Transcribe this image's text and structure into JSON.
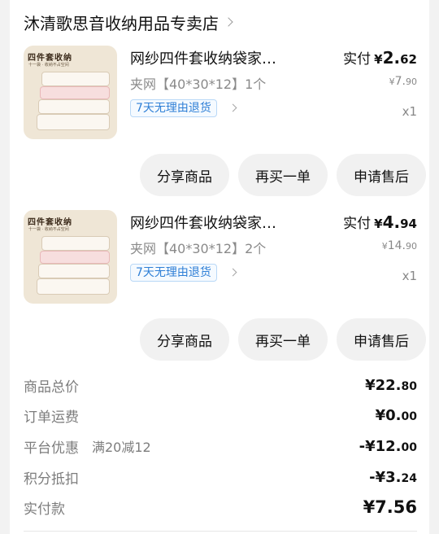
{
  "store": {
    "name": "沐清歌思音收纳用品专卖店"
  },
  "items": [
    {
      "thumb_title": "四件套收纳",
      "thumb_sub": "十一袋 · 收纳不占空间",
      "name": "网纱四件套收纳袋家用卧室衣物整理",
      "paid_label": "实付",
      "paid_currency": "¥",
      "paid_int": "2.",
      "paid_dec": "62",
      "spec": "夹网【40*30*12】1个",
      "orig_currency": "¥",
      "orig_int": "7.",
      "orig_dec": "90",
      "tag": "7天无理由退货",
      "qty": "x1",
      "buttons": [
        "分享商品",
        "再买一单",
        "申请售后"
      ]
    },
    {
      "thumb_title": "四件套收纳",
      "thumb_sub": "十一袋 · 收纳不占空间",
      "name": "网纱四件套收纳袋家用卧室衣物整理",
      "paid_label": "实付",
      "paid_currency": "¥",
      "paid_int": "4.",
      "paid_dec": "94",
      "spec": "夹网【40*30*12】2个",
      "orig_currency": "¥",
      "orig_int": "14.",
      "orig_dec": "90",
      "tag": "7天无理由退货",
      "qty": "x1",
      "buttons": [
        "分享商品",
        "再买一单",
        "申请售后"
      ]
    }
  ],
  "summary": [
    {
      "label": "商品总价",
      "note": "",
      "int": "¥22.",
      "dec": "80"
    },
    {
      "label": "订单运费",
      "note": "",
      "int": "¥0.",
      "dec": "00"
    },
    {
      "label": "平台优惠",
      "note": "满20减12",
      "int": "-¥12.",
      "dec": "00"
    },
    {
      "label": "积分抵扣",
      "note": "",
      "int": "-¥3.",
      "dec": "24"
    },
    {
      "label": "实付款",
      "note": "",
      "int": "¥7.",
      "dec": "56"
    }
  ]
}
